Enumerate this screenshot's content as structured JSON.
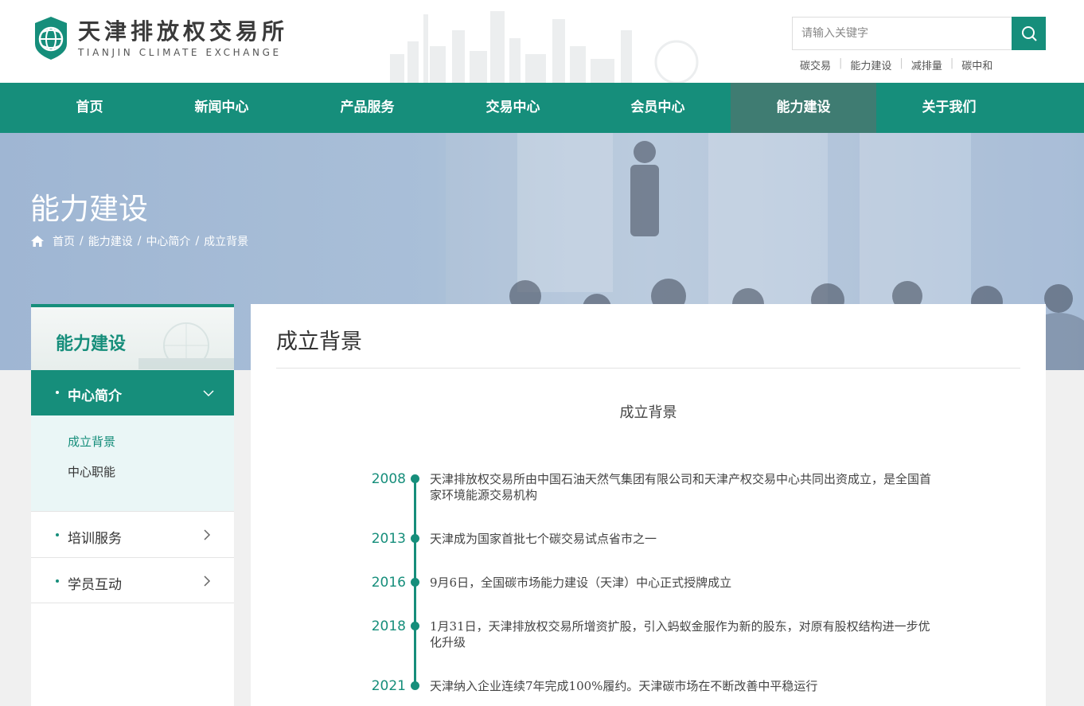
{
  "header": {
    "logo_cn": "天津排放权交易所",
    "logo_en": "TIANJIN CLIMATE EXCHANGE",
    "search_placeholder": "请输入关键字",
    "quick_links": [
      "碳交易",
      "能力建设",
      "减排量",
      "碳中和"
    ]
  },
  "nav": {
    "items": [
      "首页",
      "新闻中心",
      "产品服务",
      "交易中心",
      "会员中心",
      "能力建设",
      "关于我们"
    ],
    "active_index": 5
  },
  "banner": {
    "title": "能力建设",
    "breadcrumb": [
      "首页",
      "能力建设",
      "中心简介",
      "成立背景"
    ]
  },
  "sidebar": {
    "title": "能力建设",
    "active_section": "中心简介",
    "sub_items": [
      "成立背景",
      "中心职能"
    ],
    "sections": [
      "培训服务",
      "学员互动"
    ]
  },
  "content": {
    "title": "成立背景",
    "article_title": "成立背景",
    "timeline": [
      {
        "year": "2008",
        "text": "天津排放权交易所由中国石油天然气集团有限公司和天津产权交易中心共同出资成立，是全国首家环境能源交易机构"
      },
      {
        "year": "2013",
        "text": "天津成为国家首批七个碳交易试点省市之一"
      },
      {
        "year": "2016",
        "text": "9月6日，全国碳市场能力建设（天津）中心正式授牌成立"
      },
      {
        "year": "2018",
        "text": "1月31日，天津排放权交易所增资扩股，引入蚂蚁金服作为新的股东，对原有股权结构进一步优化升级"
      },
      {
        "year": "2021",
        "text": "天津纳入企业连续7年完成100%履约。天津碳市场在不断改善中平稳运行"
      }
    ]
  },
  "colors": {
    "primary": "#168e7b",
    "nav_active": "#3f7c72",
    "sub_bg": "#eaf6f6"
  }
}
